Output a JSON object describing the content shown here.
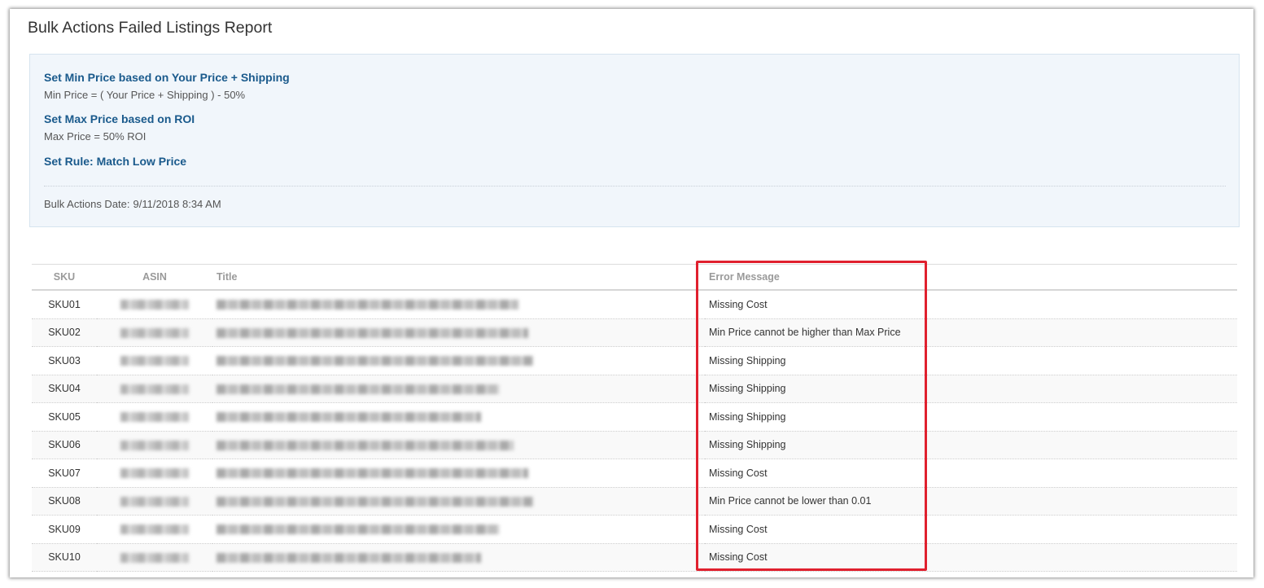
{
  "page": {
    "title": "Bulk Actions Failed Listings Report"
  },
  "summary": {
    "rules": [
      {
        "title": "Set Min Price based on Your Price + Shipping",
        "description": "Min Price = ( Your Price + Shipping ) - 50%"
      },
      {
        "title": "Set Max Price based on ROI",
        "description": "Max Price = 50% ROI"
      },
      {
        "title": "Set Rule: Match Low Price",
        "description": ""
      }
    ],
    "bulk_date_label": "Bulk Actions Date:",
    "bulk_date_value": "9/11/2018 8:34 AM"
  },
  "table": {
    "headers": {
      "sku": "SKU",
      "asin": "ASIN",
      "title": "Title",
      "error": "Error Message"
    },
    "rows": [
      {
        "sku": "SKU01",
        "error": "Missing Cost",
        "title_blur": 0.64
      },
      {
        "sku": "SKU02",
        "error": "Min Price cannot be higher than Max Price",
        "title_blur": 0.66
      },
      {
        "sku": "SKU03",
        "error": "Missing Shipping",
        "title_blur": 0.67
      },
      {
        "sku": "SKU04",
        "error": "Missing Shipping",
        "title_blur": 0.6
      },
      {
        "sku": "SKU05",
        "error": "Missing Shipping",
        "title_blur": 0.56
      },
      {
        "sku": "SKU06",
        "error": "Missing Shipping",
        "title_blur": 0.63
      },
      {
        "sku": "SKU07",
        "error": "Missing Cost",
        "title_blur": 0.66
      },
      {
        "sku": "SKU08",
        "error": "Min Price cannot be lower than 0.01",
        "title_blur": 0.67
      },
      {
        "sku": "SKU09",
        "error": "Missing Cost",
        "title_blur": 0.6
      },
      {
        "sku": "SKU10",
        "error": "Missing Cost",
        "title_blur": 0.56
      }
    ]
  },
  "colors": {
    "link_blue": "#1a5a8c",
    "highlight_red": "#e0202e",
    "summary_bg": "#f1f6fb"
  }
}
